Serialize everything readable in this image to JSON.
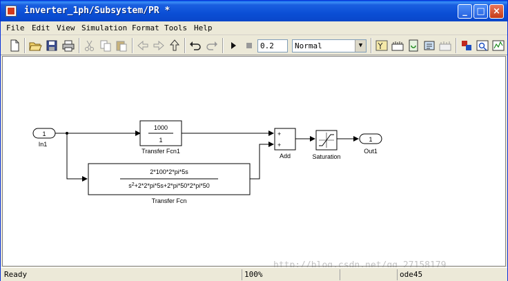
{
  "window": {
    "title": "inverter_1ph/Subsystem/PR *"
  },
  "menu": [
    "File",
    "Edit",
    "View",
    "Simulation",
    "Format",
    "Tools",
    "Help"
  ],
  "toolbar": {
    "stop_time": "0.2",
    "mode": "Normal",
    "icons": [
      "new-icon",
      "open-icon",
      "save-icon",
      "print-icon",
      "cut-icon",
      "copy-icon",
      "paste-icon",
      "back-icon",
      "forward-icon",
      "up-icon",
      "undo-icon",
      "redo-icon",
      "play-icon",
      "stop-icon",
      "library-icon",
      "build-icon",
      "update-icon",
      "refresh-icon",
      "model-explorer-icon",
      "debug-icon",
      "inspect-icon"
    ]
  },
  "diagram": {
    "in1": {
      "port": "1",
      "label": "In1"
    },
    "tf1": {
      "num": "1000",
      "den": "1",
      "label": "Transfer Fcn1"
    },
    "tf": {
      "num": "2*100*2*pi*5s",
      "den": "s2+2*2*pi*5s+2*pi*50*2*pi*50",
      "label": "Transfer Fcn"
    },
    "add": {
      "sign1": "+",
      "sign2": "+",
      "label": "Add"
    },
    "sat": {
      "label": "Saturation"
    },
    "out1": {
      "port": "1",
      "label": "Out1"
    }
  },
  "status": {
    "ready": "Ready",
    "zoom": "100%",
    "solver": "ode45"
  },
  "watermark": "http://blog.csdn.net/qq_27158179"
}
